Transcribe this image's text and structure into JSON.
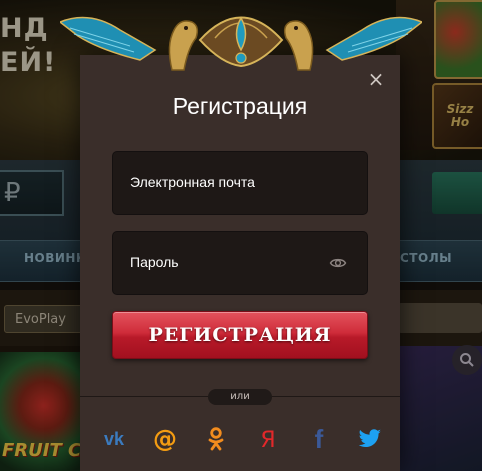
{
  "background": {
    "banner_text": "НД\nЕЙ!",
    "thumb_mid_text": "Sizz\nHo",
    "currency_symbol": "₽",
    "tab_left": "НОВИНК",
    "tab_right": "СТОЛЫ",
    "provider_select": "EvoPlay",
    "game_left_text": "FRUIT C"
  },
  "modal": {
    "title": "Регистрация",
    "close_symbol": "×",
    "email_placeholder": "Электронная почта",
    "password_placeholder": "Пароль",
    "submit_label": "РЕГИСТРАЦИЯ",
    "or_label": "или",
    "socials": [
      {
        "name": "vk",
        "glyph": "vk",
        "color": "#3b7bbf"
      },
      {
        "name": "mailru",
        "glyph": "@",
        "color": "#f39c12"
      },
      {
        "name": "odnoklassniki",
        "glyph": "ok",
        "color": "#f28c1e"
      },
      {
        "name": "yandex",
        "glyph": "Я",
        "color": "#e2282a"
      },
      {
        "name": "facebook",
        "glyph": "f",
        "color": "#3b5998"
      },
      {
        "name": "twitter",
        "glyph": "twitter",
        "color": "#1da1f2"
      }
    ]
  },
  "colors": {
    "accent_red": "#cf2c3a",
    "modal_bg": "#3a2e2a",
    "field_bg": "#1e1816"
  }
}
